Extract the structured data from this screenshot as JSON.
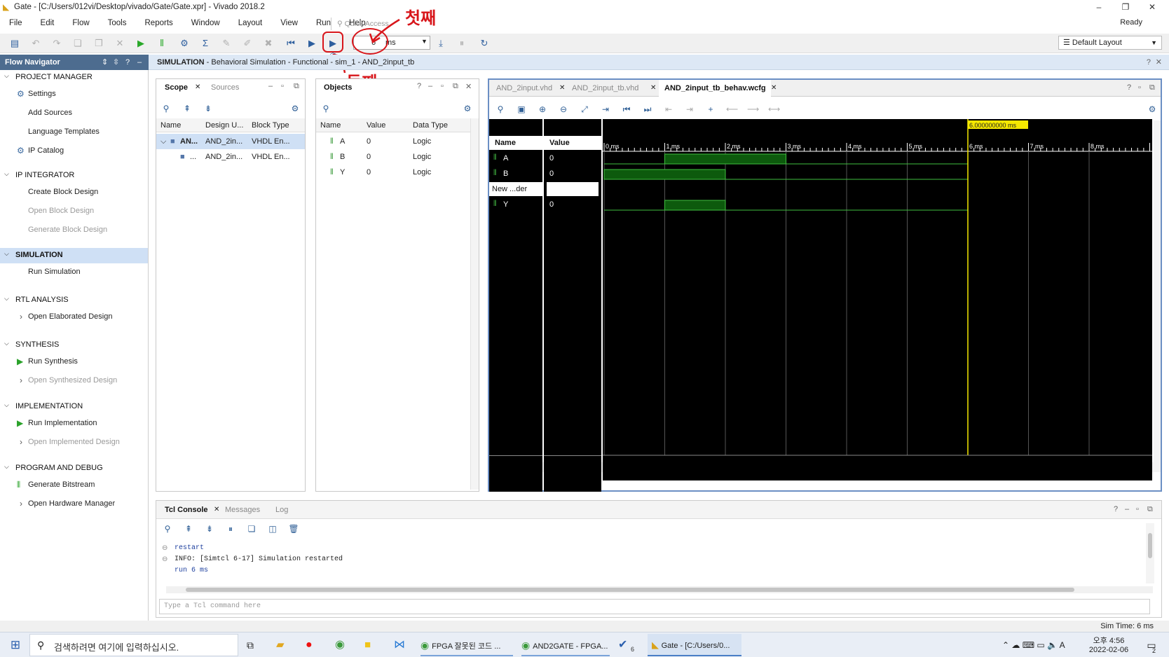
{
  "window": {
    "title": "Gate - [C:/Users/012vi/Desktop/vivado/Gate/Gate.xpr] - Vivado 2018.2",
    "status": "Ready"
  },
  "menu": [
    "File",
    "Edit",
    "Flow",
    "Tools",
    "Reports",
    "Window",
    "Layout",
    "View",
    "Run",
    "Help"
  ],
  "quick_access": {
    "placeholder": "Quick Access"
  },
  "toolbar": {
    "run_time_value": "6",
    "run_time_unit": "ms",
    "layout": "Default Layout"
  },
  "annotations": {
    "first": "첫째",
    "second": "둘째"
  },
  "flow_navigator": {
    "title": "Flow Navigator",
    "sections": [
      {
        "name": "PROJECT MANAGER",
        "items": [
          {
            "label": "Settings",
            "enabled": true,
            "icon": "gear-icon"
          },
          {
            "label": "Add Sources",
            "enabled": true
          },
          {
            "label": "Language Templates",
            "enabled": true
          },
          {
            "label": "IP Catalog",
            "enabled": true,
            "icon": "ip-icon"
          }
        ]
      },
      {
        "name": "IP INTEGRATOR",
        "items": [
          {
            "label": "Create Block Design",
            "enabled": true
          },
          {
            "label": "Open Block Design",
            "enabled": false
          },
          {
            "label": "Generate Block Design",
            "enabled": false
          }
        ]
      },
      {
        "name": "SIMULATION",
        "items": [
          {
            "label": "Run Simulation",
            "enabled": true
          }
        ]
      },
      {
        "name": "RTL ANALYSIS",
        "items": [
          {
            "label": "Open Elaborated Design",
            "enabled": true
          }
        ]
      },
      {
        "name": "SYNTHESIS",
        "items": [
          {
            "label": "Run Synthesis",
            "enabled": true,
            "icon": "play-icon"
          },
          {
            "label": "Open Synthesized Design",
            "enabled": false
          }
        ]
      },
      {
        "name": "IMPLEMENTATION",
        "items": [
          {
            "label": "Run Implementation",
            "enabled": true,
            "icon": "play-icon"
          },
          {
            "label": "Open Implemented Design",
            "enabled": false
          }
        ]
      },
      {
        "name": "PROGRAM AND DEBUG",
        "items": [
          {
            "label": "Generate Bitstream",
            "enabled": true,
            "icon": "bitstream-icon"
          },
          {
            "label": "Open Hardware Manager",
            "enabled": true
          }
        ]
      }
    ]
  },
  "sim_header": {
    "bold": "SIMULATION",
    "rest": " - Behavioral Simulation - Functional - sim_1 - AND_2input_tb"
  },
  "scope": {
    "tabs": [
      "Scope",
      "Sources"
    ],
    "columns": [
      "Name",
      "Design U...",
      "Block Type"
    ],
    "rows": [
      {
        "name": "AN...",
        "unit": "AND_2in...",
        "type": "VHDL En..."
      },
      {
        "name": "...",
        "unit": "AND_2in...",
        "type": "VHDL En..."
      }
    ]
  },
  "objects": {
    "title": "Objects",
    "columns": [
      "Name",
      "Value",
      "Data Type"
    ],
    "rows": [
      {
        "name": "A",
        "value": "0",
        "type": "Logic"
      },
      {
        "name": "B",
        "value": "0",
        "type": "Logic"
      },
      {
        "name": "Y",
        "value": "0",
        "type": "Logic"
      }
    ]
  },
  "editor_tabs": [
    "AND_2input.vhd",
    "AND_2input_tb.vhd",
    "AND_2input_tb_behav.wcfg"
  ],
  "waveform": {
    "name_header": "Name",
    "value_header": "Value",
    "signals": [
      {
        "name": "A",
        "value": "0",
        "high": [
          [
            1,
            3
          ]
        ]
      },
      {
        "name": "B",
        "value": "0",
        "high": [
          [
            0,
            2
          ]
        ]
      },
      {
        "name": "New ...der",
        "value": "",
        "divider": true
      },
      {
        "name": "Y",
        "value": "0",
        "high": [
          [
            1,
            2
          ]
        ]
      }
    ],
    "time_labels": [
      "0 ms",
      "1 ms",
      "2 ms",
      "3 ms",
      "4 ms",
      "5 ms",
      "6 ms",
      "7 ms",
      "8 ms"
    ],
    "sim_end_ms": 6,
    "cursor_ms": 6,
    "cursor_label": "6.000000000 ms"
  },
  "console": {
    "tabs": [
      "Tcl Console",
      "Messages",
      "Log"
    ],
    "lines": [
      {
        "text": "restart",
        "cmd": true
      },
      {
        "text": "INFO: [Simtcl 6-17] Simulation restarted",
        "cmd": false
      },
      {
        "text": "run 6 ms",
        "cmd": true
      }
    ],
    "input_placeholder": "Type a Tcl command here"
  },
  "status": {
    "sim_time": "Sim Time: 6 ms"
  },
  "taskbar": {
    "search_placeholder": "검색하려면 여기에 입력하십시오.",
    "tasks": [
      "FPGA 잘못된 코드 ...",
      "AND2GATE - FPGA...",
      "Gate - [C:/Users/0..."
    ],
    "time": "오후 4:56",
    "date": "2022-02-06",
    "notif_count": "2",
    "badge": "6"
  }
}
